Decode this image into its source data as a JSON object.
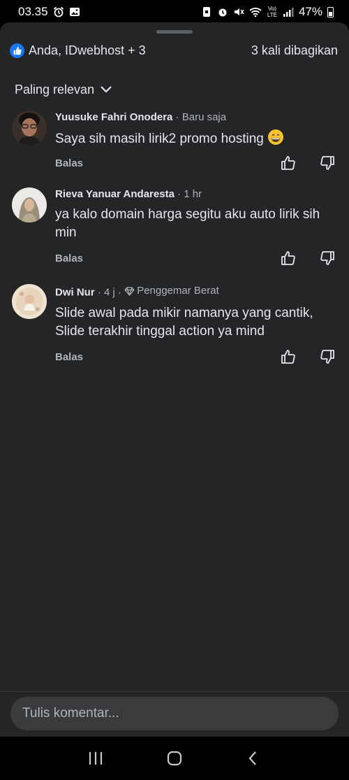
{
  "status_bar": {
    "time": "03.35",
    "battery": "47%",
    "network": "Vo) LTE"
  },
  "header": {
    "reactions_label": "Anda, IDwebhost + 3",
    "shares_label": "3 kali dibagikan",
    "sort_label": "Paling relevan"
  },
  "comments": [
    {
      "author": "Yuusuke Fahri Onodera",
      "time": "· Baru saja",
      "text": "Saya sih masih lirik2 promo hosting",
      "reply_label": "Balas"
    },
    {
      "author": "Rieva Yanuar Andaresta",
      "time": "· 1 hr",
      "text": "ya kalo domain harga segitu aku auto lirik sih min",
      "reply_label": "Balas"
    },
    {
      "author": "Dwi Nur",
      "time": "· 4 j ·",
      "badge": "Penggemar Berat",
      "text": "Slide awal pada mikir namanya yang cantik, Slide terakhir tinggal action ya mind",
      "reply_label": "Balas"
    }
  ],
  "composer": {
    "placeholder": "Tulis komentar..."
  },
  "colors": {
    "sheet_bg": "#242526",
    "accent": "#1877f2",
    "text_primary": "#e4e6eb",
    "text_secondary": "#b0b3b8"
  }
}
